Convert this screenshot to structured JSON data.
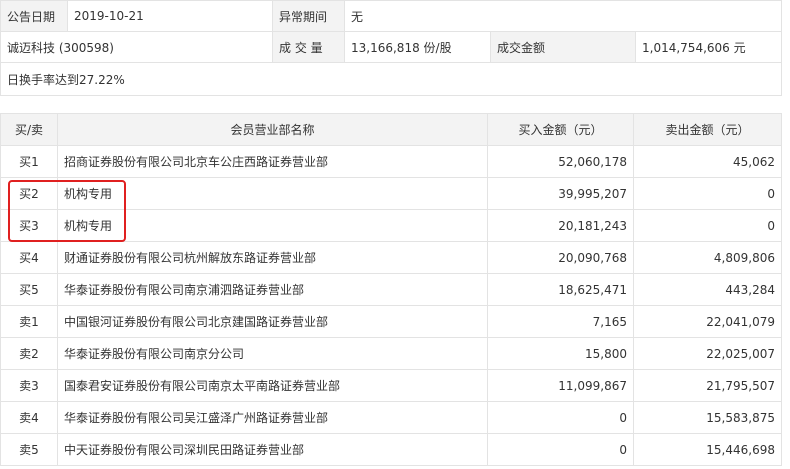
{
  "info": {
    "date_label": "公告日期",
    "date_value": "2019-10-21",
    "period_label": "异常期间",
    "period_value": "无",
    "stock": "诚迈科技 (300598)",
    "volume_label": "成 交 量",
    "volume_value": "13,166,818 份/股",
    "amount_label": "成交金额",
    "amount_value": "1,014,754,606 元",
    "reason": "日换手率达到27.22%"
  },
  "table": {
    "headers": [
      "买/卖",
      "会员营业部名称",
      "买入金额（元）",
      "卖出金额（元）"
    ],
    "rows": [
      {
        "side": "买1",
        "name": "招商证券股份有限公司北京车公庄西路证券营业部",
        "buy": "52,060,178",
        "sell": "45,062"
      },
      {
        "side": "买2",
        "name": "机构专用",
        "buy": "39,995,207",
        "sell": "0"
      },
      {
        "side": "买3",
        "name": "机构专用",
        "buy": "20,181,243",
        "sell": "0"
      },
      {
        "side": "买4",
        "name": "财通证券股份有限公司杭州解放东路证券营业部",
        "buy": "20,090,768",
        "sell": "4,809,806"
      },
      {
        "side": "买5",
        "name": "华泰证券股份有限公司南京浦泗路证券营业部",
        "buy": "18,625,471",
        "sell": "443,284"
      },
      {
        "side": "卖1",
        "name": "中国银河证券股份有限公司北京建国路证券营业部",
        "buy": "7,165",
        "sell": "22,041,079"
      },
      {
        "side": "卖2",
        "name": "华泰证券股份有限公司南京分公司",
        "buy": "15,800",
        "sell": "22,025,007"
      },
      {
        "side": "卖3",
        "name": "国泰君安证券股份有限公司南京太平南路证券营业部",
        "buy": "11,099,867",
        "sell": "21,795,507"
      },
      {
        "side": "卖4",
        "name": "华泰证券股份有限公司吴江盛泽广州路证券营业部",
        "buy": "0",
        "sell": "15,583,875"
      },
      {
        "side": "卖5",
        "name": "中天证券股份有限公司深圳民田路证券营业部",
        "buy": "0",
        "sell": "15,446,698"
      }
    ]
  },
  "highlight_color": "#e02020"
}
